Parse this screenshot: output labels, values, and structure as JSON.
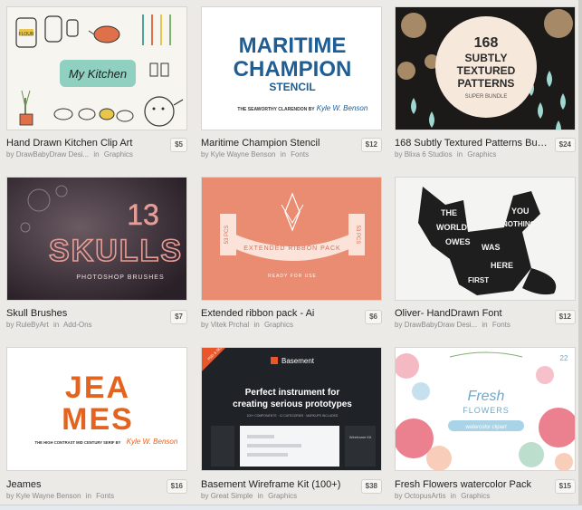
{
  "products": [
    {
      "title": "Hand Drawn Kitchen Clip Art",
      "price": "$5",
      "author": "DrawBabyDraw Desi...",
      "category": "Graphics",
      "thumb": {
        "text": "My Kitchen",
        "jar_label": "FLOUR"
      }
    },
    {
      "title": "Maritime Champion Stencil",
      "price": "$12",
      "author": "Kyle Wayne Benson",
      "category": "Fonts",
      "thumb": {
        "line1": "MARITIME",
        "line2": "CHAMPION",
        "line3": "STENCIL",
        "sub": "THE SEAWORTHY CLARENDON BY",
        "sig": "Kyle W. Benson"
      }
    },
    {
      "title": "168 Subtly Textured Patterns Bun...",
      "price": "$24",
      "author": "Blixa 6 Studios",
      "category": "Graphics",
      "thumb": {
        "line1": "168",
        "line2": "SUBTLY",
        "line3": "TEXTURED",
        "line4": "PATTERNS",
        "sub": "SUPER BUNDLE"
      }
    },
    {
      "title": "Skull Brushes",
      "price": "$7",
      "author": "RuleByArt",
      "category": "Add-Ons",
      "thumb": {
        "num": "13",
        "word": "SKULLS",
        "sub": "PHOTOSHOP BRUSHES"
      }
    },
    {
      "title": "Extended ribbon pack - Ai",
      "price": "$6",
      "author": "Vitek Prchal",
      "category": "Graphics",
      "thumb": {
        "ribbon": "EXTENDED RIBBON PACK",
        "left": "53 PCS",
        "right": "53 PCS",
        "sub": "READY FOR USE"
      }
    },
    {
      "title": "Oliver- HandDrawn Font",
      "price": "$12",
      "author": "DrawBabyDraw Desi...",
      "category": "Fonts",
      "thumb": {
        "w1": "THE",
        "w2": "WORLD",
        "w3": "OWES",
        "w4": "YOU",
        "w5": "NOTHING",
        "w6": "WAS",
        "w7": "HERE",
        "w8": "FIRST"
      }
    },
    {
      "title": "Jeames",
      "price": "$16",
      "author": "Kyle Wayne Benson",
      "category": "Fonts",
      "thumb": {
        "line1": "JEA",
        "line2": "MES",
        "sub": "THE HIGH CONTRAST MID CENTURY SERIF BY",
        "sig": "Kyle W. Benson"
      }
    },
    {
      "title": "Basement Wireframe Kit (100+)",
      "price": "$38",
      "author": "Great Simple",
      "category": "Graphics",
      "thumb": {
        "brand": "Basement",
        "badge": "PSD & SKETCH",
        "head1": "Perfect instrument for",
        "head2": "creating serious prototypes",
        "sub": "100+ COMPONENTS · 12 CATEGORIES · MARKUPS INCLUDED",
        "panel": "Wireframe Kit"
      }
    },
    {
      "title": "Fresh Flowers watercolor Pack",
      "price": "$15",
      "author": "OctopusArtis",
      "category": "Graphics",
      "thumb": {
        "line1": "Fresh",
        "line2": "FLOWERS",
        "sub": "watercolor clipart",
        "num": "22"
      }
    }
  ],
  "labels": {
    "by": "by",
    "in": "in"
  },
  "colors": {
    "maritime_blue": "#1f5d95",
    "jeames_orange": "#e4641f",
    "ribbon_coral": "#e98c72",
    "basement_dark": "#1f2226",
    "basement_accent": "#e8562a"
  }
}
